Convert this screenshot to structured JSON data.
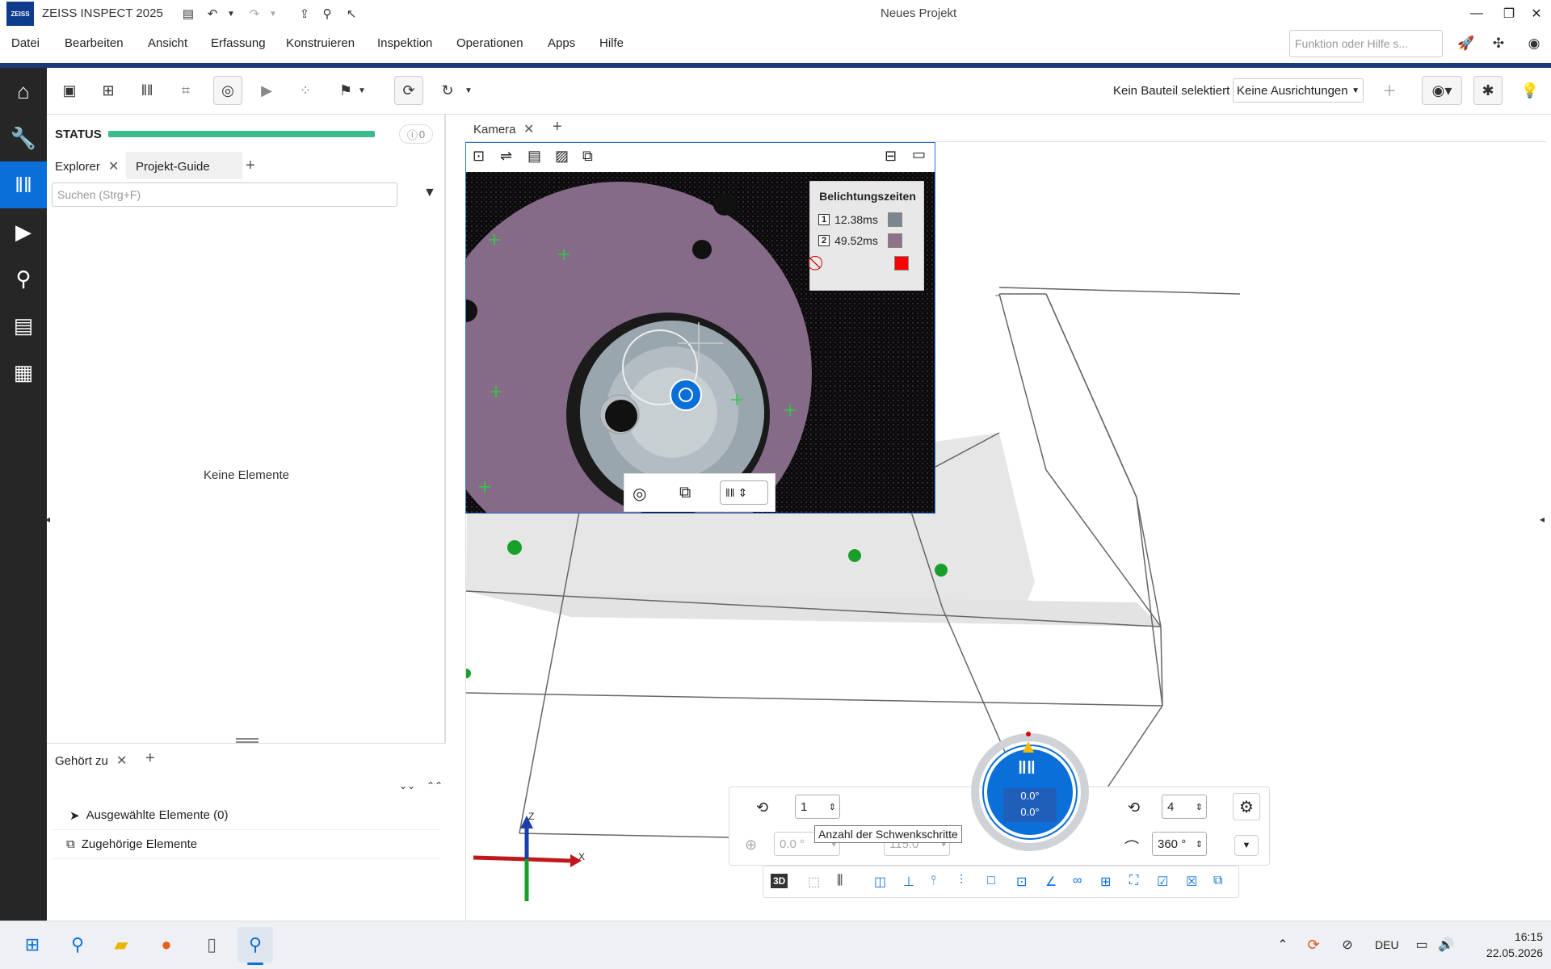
{
  "titlebar": {
    "logo": "ZEISS",
    "app_name": "ZEISS INSPECT 2025",
    "project": "Neues Projekt"
  },
  "menu": [
    "Datei",
    "Bearbeiten",
    "Ansicht",
    "Erfassung",
    "Konstruieren",
    "Inspektion",
    "Operationen",
    "Apps",
    "Hilfe"
  ],
  "search": {
    "placeholder": "Funktion oder Hilfe s..."
  },
  "toolbar": {
    "part_status": "Kein Bauteil selektiert",
    "alignment": "Keine Ausrichtungen"
  },
  "status": {
    "label": "STATUS",
    "info_count": "0",
    "progress": 1.0
  },
  "explorer": {
    "tabs": [
      "Explorer",
      "Projekt-Guide"
    ],
    "search_placeholder": "Suchen (Strg+F)",
    "empty_text": "Keine Elemente"
  },
  "belongs": {
    "tab": "Gehört zu",
    "rows": [
      "Ausgewählte Elemente (0)",
      "Zugehörige Elemente"
    ]
  },
  "viewport": {
    "tab": "Kamera"
  },
  "exposure": {
    "title": "Belichtungszeiten",
    "items": [
      {
        "index": "1",
        "time": "12.38ms",
        "color": "#7b8691"
      },
      {
        "index": "2",
        "time": "49.52ms",
        "color": "#8f7289"
      },
      {
        "index": "",
        "time": "",
        "color": "#ff0000"
      }
    ]
  },
  "rotation": {
    "steps_left": "1",
    "angle_left": "0.0 °",
    "angle_mid": "115.0",
    "steps_right": "4",
    "range": "360 °",
    "dial_value_1": "0.0°",
    "dial_value_2": "0.0°",
    "tooltip": "Anzahl der Schwenkschritte"
  },
  "axes": {
    "x": "X",
    "z": "Z"
  },
  "taskbar": {
    "lang": "DEU",
    "time": "16:15",
    "date": "22.05.2026"
  }
}
